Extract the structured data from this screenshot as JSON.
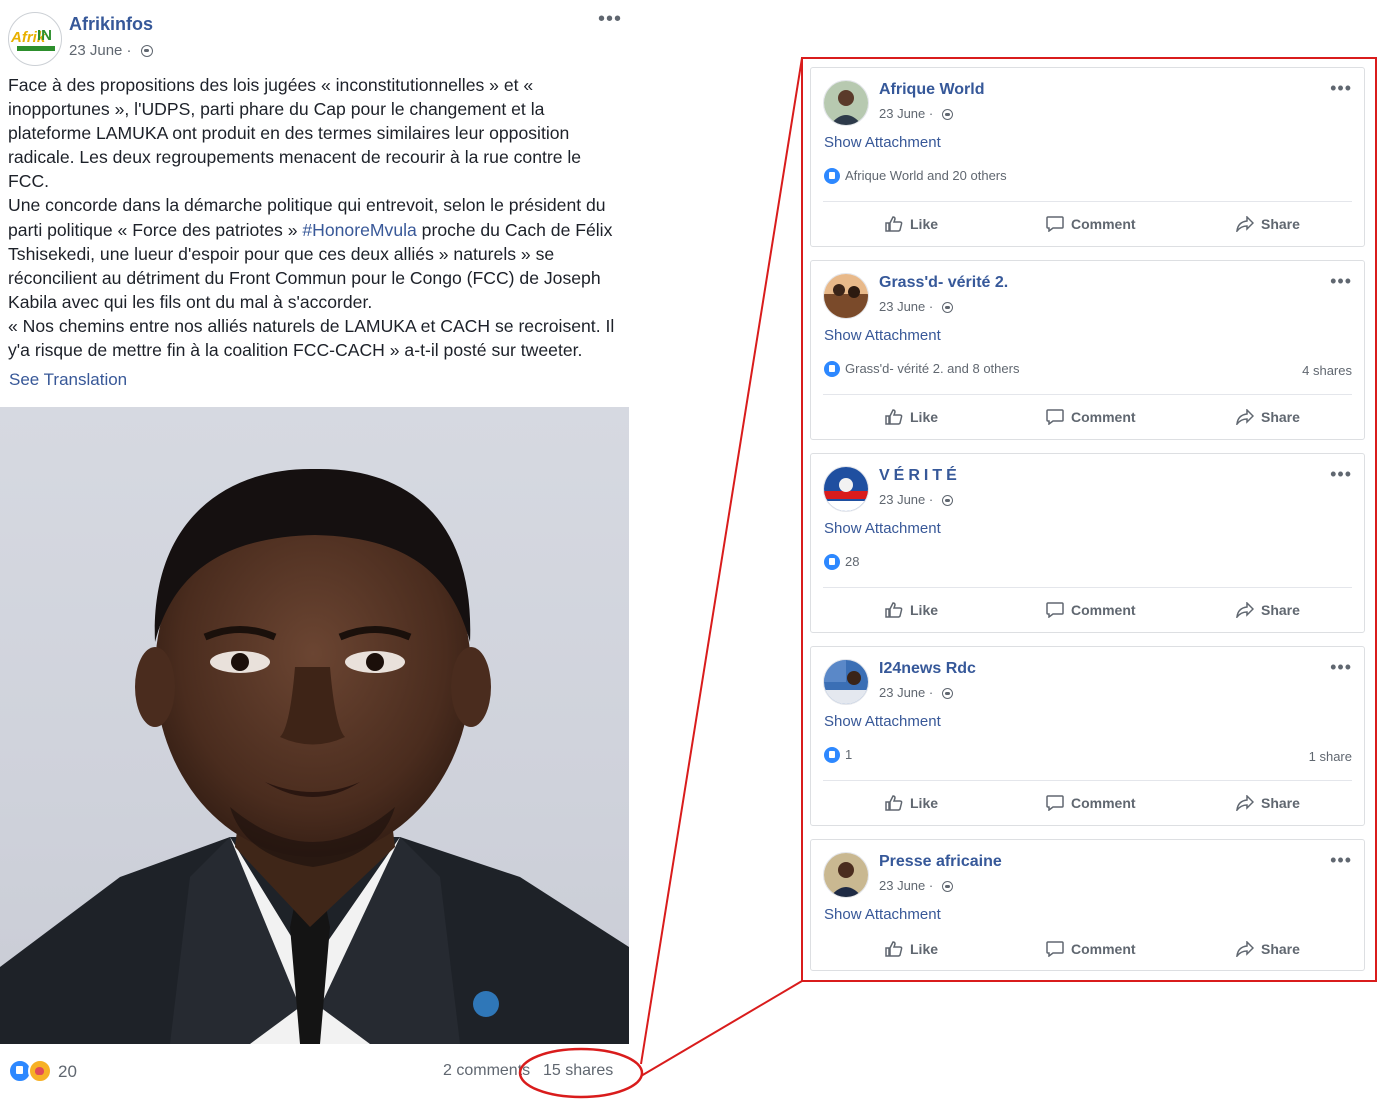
{
  "post": {
    "author": "Afrikinfos",
    "avatar_logo": "AfrikIN",
    "date": "23 June · ",
    "more": "•••",
    "paragraphs": [
      "Face à des propositions des lois jugées « inconstitutionnelles » et « inopportunes », l'UDPS, parti phare du Cap pour le changement et la plateforme LAMUKA ont produit en des termes similaires leur opposition radicale. Les deux regroupements menacent de recourir à la rue contre le FCC.",
      "Une concorde dans la démarche politique qui entrevoit, selon le président du parti politique « Force des patriotes » ",
      "« Nos chemins entre nos alliés naturels de LAMUKA et CACH se recroisent. Il y'a risque de mettre fin à la coalition FCC-CACH » a-t-il posté sur tweeter."
    ],
    "hashtag": "#HonoreMvula",
    "paragraph2_tail": " proche du Cach de Félix Tshisekedi, une lueur d'espoir pour que ces deux alliés » naturels » se réconcilient au détriment du Front Commun pour le Congo (FCC) de Joseph Kabila avec qui les fils ont du mal à s'accorder.",
    "see_translation": "See Translation",
    "reaction_count": "20",
    "comments": "2 comments",
    "shares": "15 shares"
  },
  "shares_panel": {
    "cards": [
      {
        "name": "Afrique World",
        "date": "23 June · ",
        "attachment": "Show Attachment",
        "reactions": "Afrique World and 20 others",
        "shares": ""
      },
      {
        "name": "Grass'd- vérité 2.",
        "date": "23 June · ",
        "attachment": "Show Attachment",
        "reactions": "Grass'd- vérité 2. and 8 others",
        "shares": "4 shares"
      },
      {
        "name": "VÉRITÉ",
        "date": "23 June · ",
        "attachment": "Show Attachment",
        "reactions": "28",
        "shares": ""
      },
      {
        "name": "I24news Rdc",
        "date": "23 June · ",
        "attachment": "Show Attachment",
        "reactions": "1",
        "shares": "1 share"
      },
      {
        "name": "Presse africaine",
        "date": "23 June · ",
        "attachment": "Show Attachment",
        "reactions": "",
        "shares": ""
      }
    ],
    "actions": {
      "like": "Like",
      "comment": "Comment",
      "share": "Share",
      "more": "•••"
    }
  },
  "colors": {
    "link": "#365899",
    "annotation_red": "#d91c1c",
    "like_blue": "#2d88ff",
    "meta_gray": "#606770"
  },
  "icons": [
    "globe-icon",
    "more-icon",
    "like-reaction-icon",
    "care-reaction-icon",
    "thumbs-up-icon",
    "comment-icon",
    "share-icon"
  ]
}
